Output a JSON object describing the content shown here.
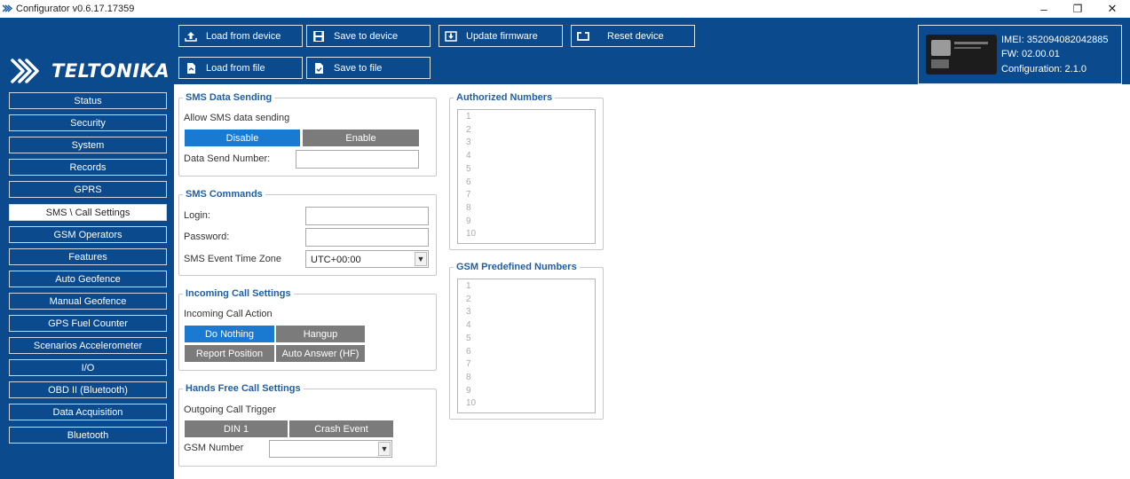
{
  "window": {
    "title": "Configurator v0.6.17.17359",
    "app_icon": "teltonika-small-icon",
    "controls": {
      "minimize": "–",
      "maximize": "❐",
      "close": "✕"
    }
  },
  "brand": {
    "logo_text": "TELTONIKA",
    "logo_icon": "teltonika-arrows-icon",
    "color": "#0a4a8d"
  },
  "toolbar": {
    "load_from_device": "Load from device",
    "save_to_device": "Save to device",
    "update_firmware": "Update firmware",
    "reset_device": "Reset device",
    "load_from_file": "Load from file",
    "save_to_file": "Save to file"
  },
  "device": {
    "imei": "IMEI: 352094082042885",
    "fw": "FW: 02.00.01",
    "configuration": "Configuration: 2.1.0"
  },
  "sidebar": {
    "items": [
      {
        "label": "Status"
      },
      {
        "label": "Security"
      },
      {
        "label": "System"
      },
      {
        "label": "Records"
      },
      {
        "label": "GPRS"
      },
      {
        "label": "SMS \\ Call Settings",
        "active": true
      },
      {
        "label": "GSM Operators"
      },
      {
        "label": "Features"
      },
      {
        "label": "Auto Geofence"
      },
      {
        "label": "Manual Geofence"
      },
      {
        "label": "GPS Fuel Counter"
      },
      {
        "label": "Scenarios Accelerometer"
      },
      {
        "label": "I/O"
      },
      {
        "label": "OBD II (Bluetooth)"
      },
      {
        "label": "Data Acquisition"
      },
      {
        "label": "Bluetooth"
      }
    ]
  },
  "sms_data_sending": {
    "legend": "SMS Data Sending",
    "allow_label": "Allow SMS data sending",
    "options": [
      "Disable",
      "Enable"
    ],
    "selected": "Disable",
    "number_label": "Data Send Number:",
    "number_value": ""
  },
  "sms_commands": {
    "legend": "SMS Commands",
    "login_label": "Login:",
    "login_value": "",
    "password_label": "Password:",
    "password_value": "",
    "timezone_label": "SMS Event Time Zone",
    "timezone_value": "UTC+00:00"
  },
  "incoming_call": {
    "legend": "Incoming Call Settings",
    "action_label": "Incoming Call Action",
    "options": [
      "Do Nothing",
      "Hangup",
      "Report Position",
      "Auto Answer (HF)"
    ],
    "selected": "Do Nothing"
  },
  "hands_free": {
    "legend": "Hands Free Call Settings",
    "trigger_label": "Outgoing Call Trigger",
    "options": [
      "DIN 1",
      "Crash Event"
    ],
    "gsm_label": "GSM Number",
    "gsm_value": ""
  },
  "authorized_numbers": {
    "legend": "Authorized Numbers",
    "lines": [
      "1",
      "2",
      "3",
      "4",
      "5",
      "6",
      "7",
      "8",
      "9",
      "10"
    ]
  },
  "gsm_predefined": {
    "legend": "GSM Predefined Numbers",
    "lines": [
      "1",
      "2",
      "3",
      "4",
      "5",
      "6",
      "7",
      "8",
      "9",
      "10"
    ]
  },
  "colors": {
    "accent_blue": "#1a79d1",
    "segment_gray": "#7b7b7b",
    "legend_blue": "#1f5fa6"
  }
}
